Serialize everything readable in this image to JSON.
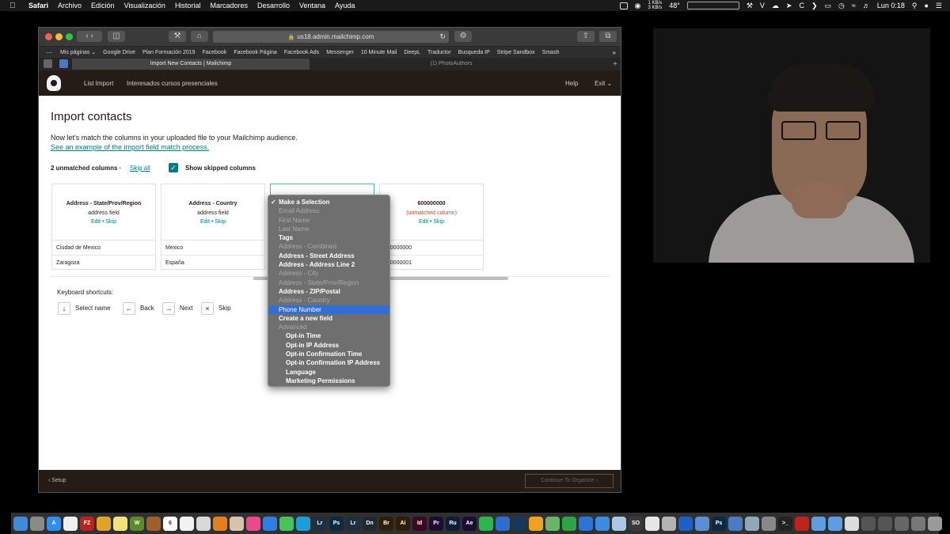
{
  "menubar": {
    "app": "Safari",
    "items": [
      "Archivo",
      "Edición",
      "Visualización",
      "Historial",
      "Marcadores",
      "Desarrollo",
      "Ventana",
      "Ayuda"
    ],
    "speed_up": "1 KB/s",
    "speed_down": "3 KB/s",
    "temp": "48°",
    "clock": "Lun 0:18"
  },
  "browser": {
    "url": "us18.admin.mailchimp.com",
    "favorites": [
      "Mis páginas ⌄",
      "Google Drive",
      "Plan Formación 2019",
      "Facebook",
      "Facebook Página",
      "Facebook Ads",
      "Messenger",
      "10 Minute Mail",
      "DeepL",
      "Traductor",
      "Busqueda IP",
      "Stripe Sandbox",
      "Smash"
    ],
    "tabs": {
      "active": "Import New Contacts | Mailchimp",
      "inactive": "(1) PhotoAuthors"
    }
  },
  "mailchimp": {
    "nav": {
      "list_import": "List Import",
      "audience": "Interesados cursos presenciales",
      "help": "Help",
      "exit": "Exit ⌄"
    },
    "page": {
      "title": "Import contacts",
      "description": "Now let's match the columns in your uploaded file to your Mailchimp audience.",
      "example_link": "See an example of the import field match process.",
      "unmatched": "2 unmatched columns ·",
      "skip_all": "Skip all",
      "show_skipped": "Show skipped columns"
    },
    "columns": [
      {
        "header": "Address - State/Prov/Region",
        "sub": "address field",
        "actions": "Edit • Skip",
        "cells": [
          "Ciudad de Mexico",
          "Zaragoza"
        ]
      },
      {
        "header": "Address - Country",
        "sub": "address field",
        "actions": "Edit • Skip",
        "cells": [
          "Mexico",
          "España"
        ]
      },
      {
        "header": "",
        "sub": "",
        "actions": "",
        "cells": [
          "",
          ""
        ]
      },
      {
        "header": "600000000",
        "sub": "(unmatched column)",
        "actions": "Edit • Skip",
        "cells": [
          "600000000",
          "600000001"
        ]
      }
    ],
    "shortcuts": {
      "title": "Keyboard shortcuts:",
      "select_key": "↓",
      "select": "Select name",
      "back_key": "←",
      "back": "Back",
      "next_key": "→",
      "next": "Next",
      "skip_key": "×",
      "skip": "Skip"
    },
    "footer": {
      "setup": "‹  Setup",
      "continue": "Continue To Organize  ›"
    }
  },
  "dropdown": {
    "options": [
      {
        "label": "Make a Selection",
        "style": "strong",
        "checked": true
      },
      {
        "label": "Email Address",
        "style": "dim"
      },
      {
        "label": "First Name",
        "style": "dim"
      },
      {
        "label": "Last Name",
        "style": "dim"
      },
      {
        "label": "Tags",
        "style": "strong"
      },
      {
        "label": "Address - Combined",
        "style": "dim"
      },
      {
        "label": "Address - Street Address",
        "style": "strong"
      },
      {
        "label": "Address - Address Line 2",
        "style": "strong"
      },
      {
        "label": "Address - City",
        "style": "dim"
      },
      {
        "label": "Address - State/Prov/Region",
        "style": "dim"
      },
      {
        "label": "Address - ZIP/Postal",
        "style": "strong"
      },
      {
        "label": "Address - Country",
        "style": "dim"
      },
      {
        "label": "Phone Number",
        "style": "sel"
      },
      {
        "label": "Create a new field",
        "style": "strong"
      },
      {
        "label": "Advanced",
        "style": "dim"
      },
      {
        "label": "Opt-in Time",
        "style": "sub"
      },
      {
        "label": "Opt-in IP Address",
        "style": "sub"
      },
      {
        "label": "Opt-in Confirmation Time",
        "style": "sub"
      },
      {
        "label": "Opt-in Confirmation IP Address",
        "style": "sub"
      },
      {
        "label": "Language",
        "style": "sub"
      },
      {
        "label": "Marketing Permissions",
        "style": "sub"
      }
    ]
  },
  "dock": {
    "apps": [
      {
        "name": "finder-icon",
        "color": "#3d8bd9",
        "text": ""
      },
      {
        "name": "launchpad-icon",
        "color": "#8a8a8a",
        "text": ""
      },
      {
        "name": "appstore-icon",
        "color": "#2d8ff0",
        "text": "A"
      },
      {
        "name": "clock-icon",
        "color": "#eeeeee",
        "text": ""
      },
      {
        "name": "filezilla-icon",
        "color": "#b8231f",
        "text": "FZ"
      },
      {
        "name": "chrome-icon",
        "color": "#e0a325",
        "text": ""
      },
      {
        "name": "notes-icon",
        "color": "#f3e27a",
        "text": ""
      },
      {
        "name": "wordpress-icon",
        "color": "#5a8c2a",
        "text": "W"
      },
      {
        "name": "notebook-icon",
        "color": "#a0602b",
        "text": ""
      },
      {
        "name": "calendar-icon",
        "color": "#ffffff",
        "text": "6"
      },
      {
        "name": "reminders-icon",
        "color": "#f2f2f2",
        "text": ""
      },
      {
        "name": "textedit-icon",
        "color": "#d9d9d9",
        "text": ""
      },
      {
        "name": "vlc-icon",
        "color": "#e57f1c",
        "text": ""
      },
      {
        "name": "photos-icon",
        "color": "#d7c4a8",
        "text": ""
      },
      {
        "name": "itunes-icon",
        "color": "#e84a8a",
        "text": ""
      },
      {
        "name": "safari-icon",
        "color": "#2e7ee3",
        "text": ""
      },
      {
        "name": "messages-icon",
        "color": "#44c45a",
        "text": ""
      },
      {
        "name": "facetime-icon",
        "color": "#1e9dd8",
        "text": ""
      },
      {
        "name": "lightroom-icon",
        "color": "#1e3040",
        "text": "Lr"
      },
      {
        "name": "photoshop-icon",
        "color": "#0b2a44",
        "text": "Ps"
      },
      {
        "name": "lightroom-classic-icon",
        "color": "#1e3040",
        "text": "Lr"
      },
      {
        "name": "dimension-icon",
        "color": "#1d2b30",
        "text": "Dn"
      },
      {
        "name": "bridge-icon",
        "color": "#2f1f05",
        "text": "Br"
      },
      {
        "name": "illustrator-icon",
        "color": "#321c05",
        "text": "Ai"
      },
      {
        "name": "indesign-icon",
        "color": "#3b0920",
        "text": "Id"
      },
      {
        "name": "premiere-icon",
        "color": "#1f0a33",
        "text": "Pr"
      },
      {
        "name": "rush-icon",
        "color": "#0b1f3a",
        "text": "Ru"
      },
      {
        "name": "aftereffects-icon",
        "color": "#1c0b33",
        "text": "Ae"
      },
      {
        "name": "whatsapp-icon",
        "color": "#2fb64a",
        "text": ""
      },
      {
        "name": "edge-icon",
        "color": "#2b6dd1",
        "text": ""
      },
      {
        "name": "codeeditor-icon",
        "color": "#16385a",
        "text": ""
      },
      {
        "name": "pages-icon",
        "color": "#f0a024",
        "text": ""
      },
      {
        "name": "maps-icon",
        "color": "#6ab36a",
        "text": ""
      },
      {
        "name": "numbers-icon",
        "color": "#2da544",
        "text": ""
      },
      {
        "name": "keynote-icon",
        "color": "#2b73d6",
        "text": ""
      },
      {
        "name": "mail-icon",
        "color": "#3b8ce4",
        "text": ""
      },
      {
        "name": "preview-icon",
        "color": "#aac8e6",
        "text": ""
      },
      {
        "name": "soundsource-icon",
        "color": "#3a3a3a",
        "text": "SO"
      },
      {
        "name": "soccer-icon",
        "color": "#e6e6e6",
        "text": ""
      },
      {
        "name": "screenflow-icon",
        "color": "#b3b3b3",
        "text": ""
      },
      {
        "name": "teamviewer-icon",
        "color": "#1d5fc7",
        "text": ""
      },
      {
        "name": "network-icon",
        "color": "#5a8fd6",
        "text": ""
      },
      {
        "name": "photoshop-small-icon",
        "color": "#0b2a44",
        "text": "Ps"
      },
      {
        "name": "finder-window-icon",
        "color": "#4a7cc4",
        "text": ""
      },
      {
        "name": "preview-image-icon",
        "color": "#91a7ba",
        "text": ""
      },
      {
        "name": "script-icon",
        "color": "#888888",
        "text": ""
      },
      {
        "name": "terminal-icon",
        "color": "#222222",
        "text": ">_"
      },
      {
        "name": "acrobat-icon",
        "color": "#c0231a",
        "text": ""
      },
      {
        "name": "folder-icon",
        "color": "#5d9de0",
        "text": ""
      },
      {
        "name": "folder2-icon",
        "color": "#5d9de0",
        "text": ""
      },
      {
        "name": "doc-icon",
        "color": "#dddddd",
        "text": ""
      },
      {
        "name": "python-icon",
        "color": "#555555",
        "text": ""
      },
      {
        "name": "python2-icon",
        "color": "#555555",
        "text": ""
      },
      {
        "name": "window-icon",
        "color": "#666666",
        "text": ""
      },
      {
        "name": "window2-icon",
        "color": "#777777",
        "text": ""
      },
      {
        "name": "trash-icon",
        "color": "#9a9a9a",
        "text": ""
      }
    ]
  }
}
